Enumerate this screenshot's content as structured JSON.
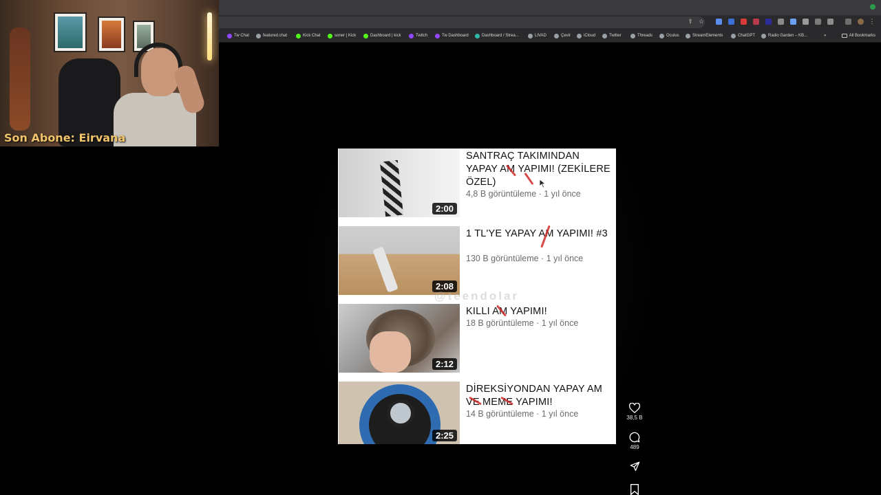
{
  "browser": {
    "bookmarks": [
      {
        "label": "Tw Chat"
      },
      {
        "label": "featured.chat"
      },
      {
        "label": "Kick Chat"
      },
      {
        "label": "soner | Kick"
      },
      {
        "label": "Dashboard | kick"
      },
      {
        "label": "Twitch"
      },
      {
        "label": "Tw Dashboard"
      },
      {
        "label": "Dashboard / Strea..."
      },
      {
        "label": "LIVAD"
      },
      {
        "label": "Çevir"
      },
      {
        "label": "iCloud"
      },
      {
        "label": "Twitter"
      },
      {
        "label": "Threads"
      },
      {
        "label": "Oculus"
      },
      {
        "label": "StreamElements"
      },
      {
        "label": "ChatGPT"
      },
      {
        "label": "Radio Garden – KB..."
      }
    ],
    "overflow_label": "»",
    "all_bookmarks_label": "All Bookmarks"
  },
  "webcam": {
    "label": "Son Abone: Eirvana"
  },
  "reel": {
    "watermark": "@teendolar",
    "videos": [
      {
        "title": "SANTRAÇ TAKIMINDAN YAPAY AM YAPIMI! (ZEKİLERE ÖZEL)",
        "meta": "4,8 B görüntüleme · 1 yıl önce",
        "duration": "2:00"
      },
      {
        "title": "1 TL'YE YAPAY AM YAPIMI! #3",
        "meta": "130 B görüntüleme · 1 yıl önce",
        "duration": "2:08"
      },
      {
        "title": "KILLI AM YAPIMI!",
        "meta": "18 B görüntüleme · 1 yıl önce",
        "duration": "2:12"
      },
      {
        "title": "DİREKSİYONDAN YAPAY AM VE MEME YAPIMI!",
        "meta": "14 B görüntüleme · 1 yıl önce",
        "duration": "2:25"
      }
    ],
    "actions": {
      "like": {
        "icon": "heart-icon",
        "count": "38,5 B"
      },
      "comment": {
        "icon": "comment-icon",
        "count": "489"
      },
      "share": {
        "icon": "send-icon"
      },
      "save": {
        "icon": "bookmark-icon"
      }
    }
  },
  "colors": {
    "page_bg": "#000000",
    "webcam_label": "#f2c46a",
    "annotation_red": "#d02a2a"
  }
}
